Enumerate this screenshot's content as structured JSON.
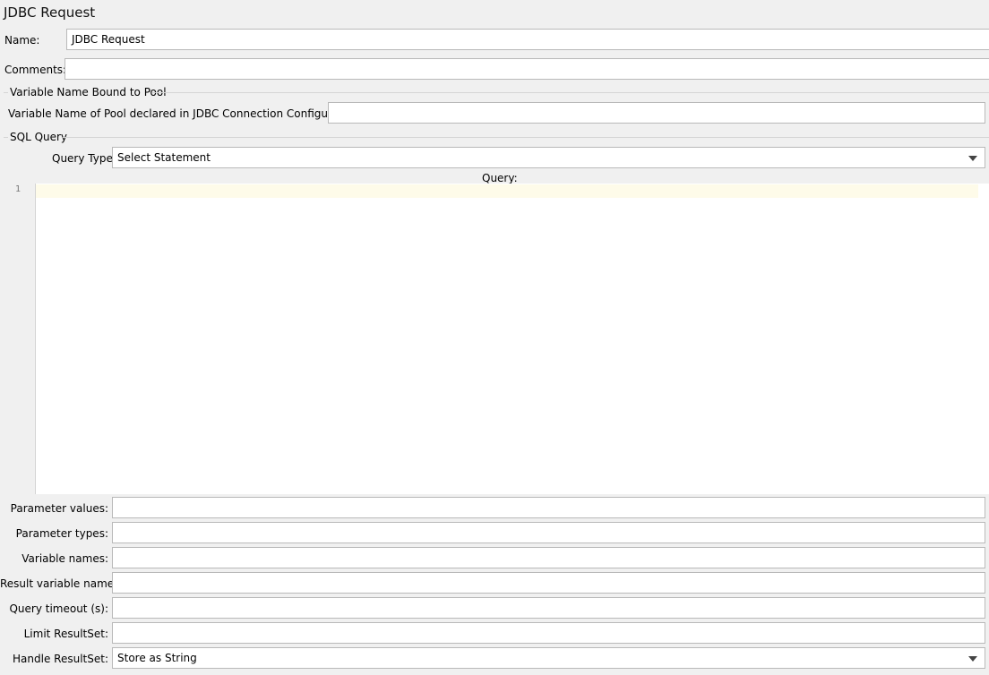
{
  "panel": {
    "title": "JDBC Request"
  },
  "name": {
    "label": "Name:",
    "value": "JDBC Request"
  },
  "comments": {
    "label": "Comments:",
    "value": ""
  },
  "pool_section": {
    "title": "Variable Name Bound to Pool",
    "label": "Variable Name of Pool declared in JDBC Connection Configuration:",
    "value": ""
  },
  "sql_section": {
    "title": "SQL Query",
    "query_type": {
      "label": "Query Type:",
      "value": "Select Statement"
    },
    "query_label": "Query:",
    "editor": {
      "line_numbers": [
        "1"
      ],
      "text": ""
    }
  },
  "params": [
    {
      "label": "Parameter values:",
      "value": ""
    },
    {
      "label": "Parameter types:",
      "value": ""
    },
    {
      "label": "Variable names:",
      "value": ""
    },
    {
      "label": "Result variable name:",
      "value": ""
    },
    {
      "label": "Query timeout (s):",
      "value": ""
    },
    {
      "label": "Limit ResultSet:",
      "value": ""
    }
  ],
  "handle_resultset": {
    "label": "Handle ResultSet:",
    "value": "Store as String"
  }
}
